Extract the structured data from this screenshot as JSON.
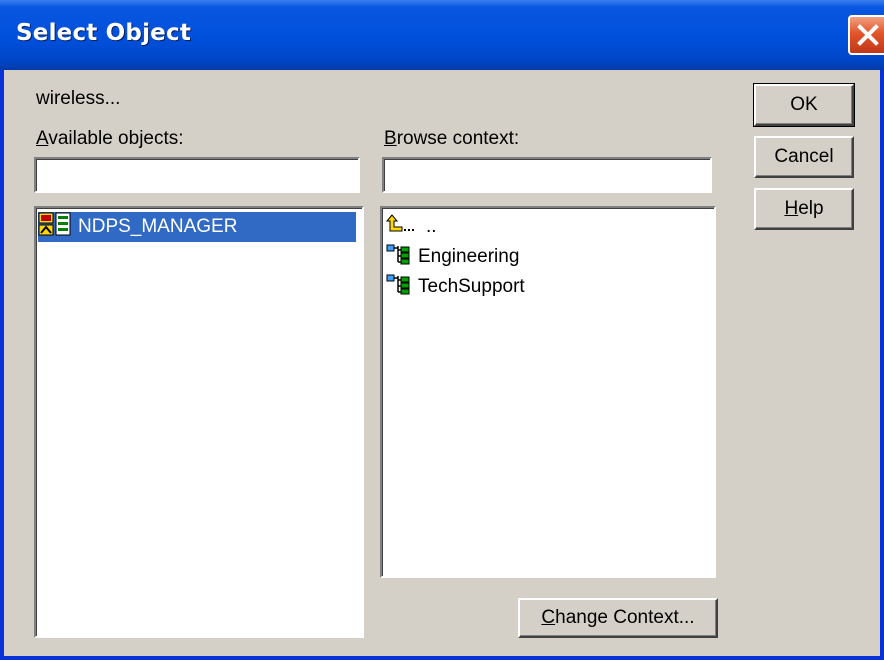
{
  "window": {
    "title": "Select Object",
    "subtitle": "wireless..."
  },
  "available": {
    "label_accel": "A",
    "label_rest": "vailable objects:",
    "filter_value": "",
    "items": [
      {
        "label": "NDPS_MANAGER",
        "icon": "ndps-manager-icon",
        "selected": true
      }
    ]
  },
  "browse": {
    "label_accel": "B",
    "label_rest": "rowse context:",
    "filter_value": "",
    "items": [
      {
        "label": "..",
        "icon": "parent-context-icon"
      },
      {
        "label": "Engineering",
        "icon": "organizational-unit-icon"
      },
      {
        "label": "TechSupport",
        "icon": "organizational-unit-icon"
      }
    ]
  },
  "buttons": {
    "ok": "OK",
    "cancel": "Cancel",
    "help_accel": "H",
    "help_rest": "elp",
    "change_context_accel": "C",
    "change_context_rest": "hange Context..."
  },
  "colors": {
    "title_bar": "#0050dc",
    "selection": "#316ac5",
    "dialog_face": "#d4d0c8",
    "close_button": "#e2552b"
  }
}
